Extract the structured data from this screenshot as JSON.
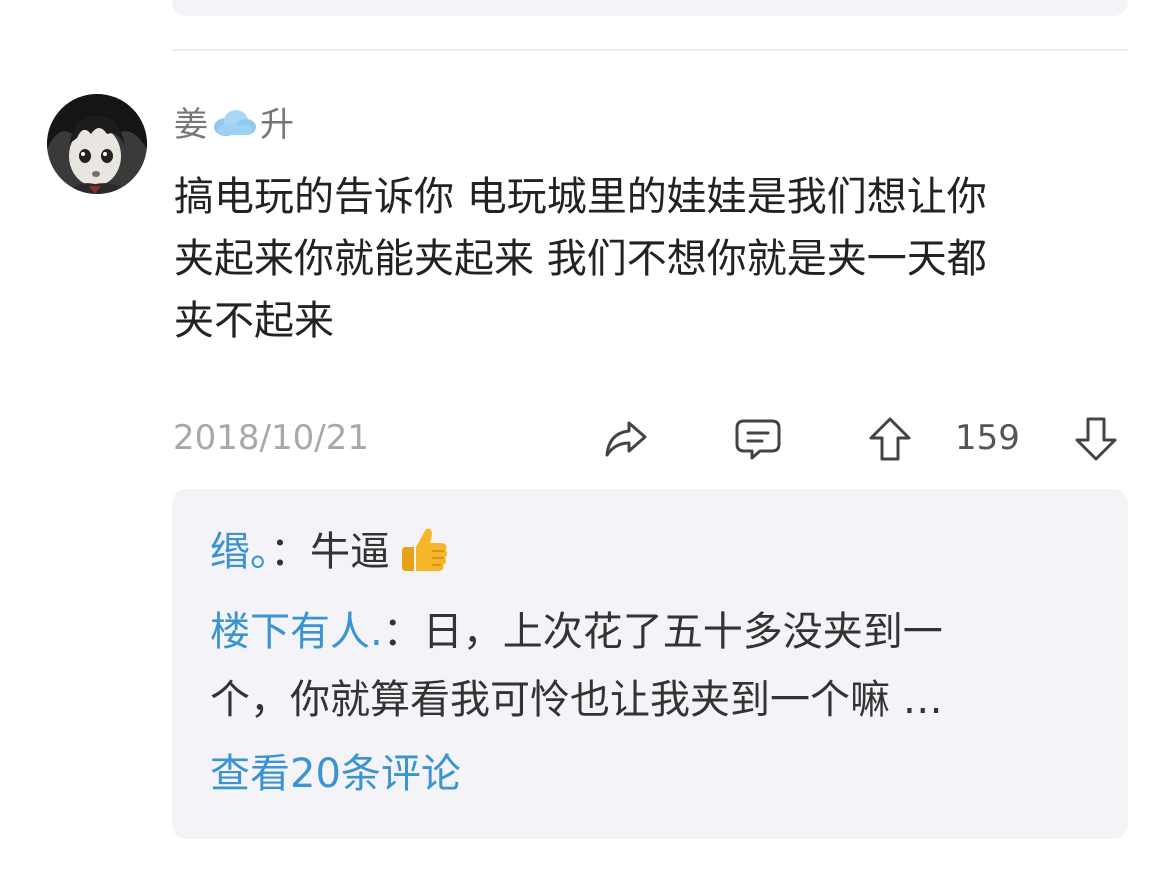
{
  "comment": {
    "username_part1": "姜",
    "username_icon": "cloud-emoji",
    "username_part2": "升",
    "avatar_icon": "anime-boy-avatar",
    "body_lines": [
      "搞电玩的告诉你 电玩城里的娃娃是我们想让你",
      "夹起来你就能夹起来 我们不想你就是夹一天都",
      "夹不起来"
    ],
    "date": "2018/10/21",
    "vote_count": "159",
    "icons": {
      "share": "share-arrow-icon",
      "reply": "comment-bubble-icon",
      "upvote": "arrow-up-icon",
      "downvote": "arrow-down-icon"
    }
  },
  "replies": {
    "items": [
      {
        "name": "缗。",
        "sep": "：",
        "text": "牛逼",
        "emoji": "thumbs-up-emoji"
      },
      {
        "name": "楼下有人.",
        "sep": "：",
        "text": "日，上次花了五十多没夹到一",
        "text2": "个，你就算看我可怜也让我夹到一个嘛 …"
      }
    ],
    "view_more": "查看20条评论"
  },
  "colors": {
    "link_blue": "#3a94d1",
    "reply_bg": "#f4f4f8",
    "muted_gray": "#a8a8a8",
    "text_dark": "#222222"
  }
}
